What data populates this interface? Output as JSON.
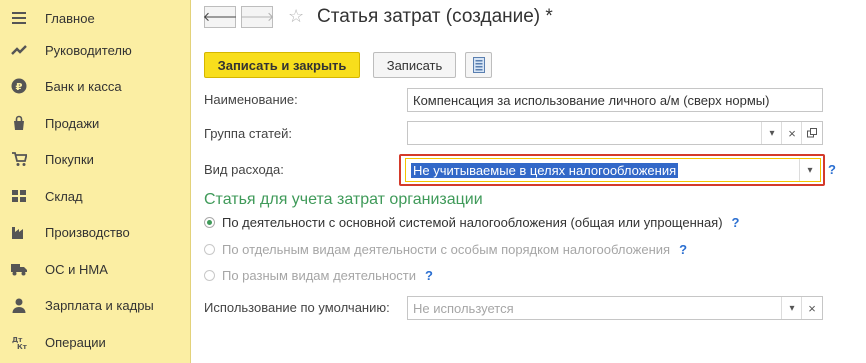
{
  "sidebar": {
    "items": [
      {
        "label": "Главное",
        "icon": "menu-icon"
      },
      {
        "label": "Руководителю",
        "icon": "trend-icon"
      },
      {
        "label": "Банк и касса",
        "icon": "ruble-icon"
      },
      {
        "label": "Продажи",
        "icon": "bag-icon"
      },
      {
        "label": "Покупки",
        "icon": "cart-icon"
      },
      {
        "label": "Склад",
        "icon": "warehouse-icon"
      },
      {
        "label": "Производство",
        "icon": "factory-icon"
      },
      {
        "label": "ОС и НМА",
        "icon": "truck-icon"
      },
      {
        "label": "Зарплата и кадры",
        "icon": "person-icon"
      },
      {
        "label": "Операции",
        "icon": "operations-icon"
      }
    ]
  },
  "header": {
    "back": "🡐",
    "forward": "🡒",
    "star": "☆",
    "title": "Статья затрат (создание) *"
  },
  "toolbar": {
    "save_close_label": "Записать и закрыть",
    "save_label": "Записать"
  },
  "form": {
    "name_label": "Наименование:",
    "name_value": "Компенсация за использование личного а/м (сверх нормы)",
    "group_label": "Группа статей:",
    "group_value": "",
    "expense_type_label": "Вид расхода:",
    "expense_type_value": "Не учитываемые в целях налогообложения",
    "help": "?",
    "dropdown_glyph": "▾",
    "clear_glyph": "×"
  },
  "section": {
    "title": "Статья для учета затрат организации",
    "options": [
      {
        "label": "По деятельности с основной системой налогообложения (общая или упрощенная)",
        "selected": true,
        "enabled": true
      },
      {
        "label": "По отдельным видам деятельности с особым порядком налогообложения",
        "selected": false,
        "enabled": false
      },
      {
        "label": "По разным видам деятельности",
        "selected": false,
        "enabled": false
      }
    ]
  },
  "default_usage": {
    "label": "Использование по умолчанию:",
    "value": "Не используется"
  },
  "colors": {
    "sidebar_bg": "#fbeea3",
    "primary_button": "#f8de1c",
    "section_title": "#3f9a59",
    "highlight_border": "#d43a2a",
    "selection": "#3268c8"
  }
}
